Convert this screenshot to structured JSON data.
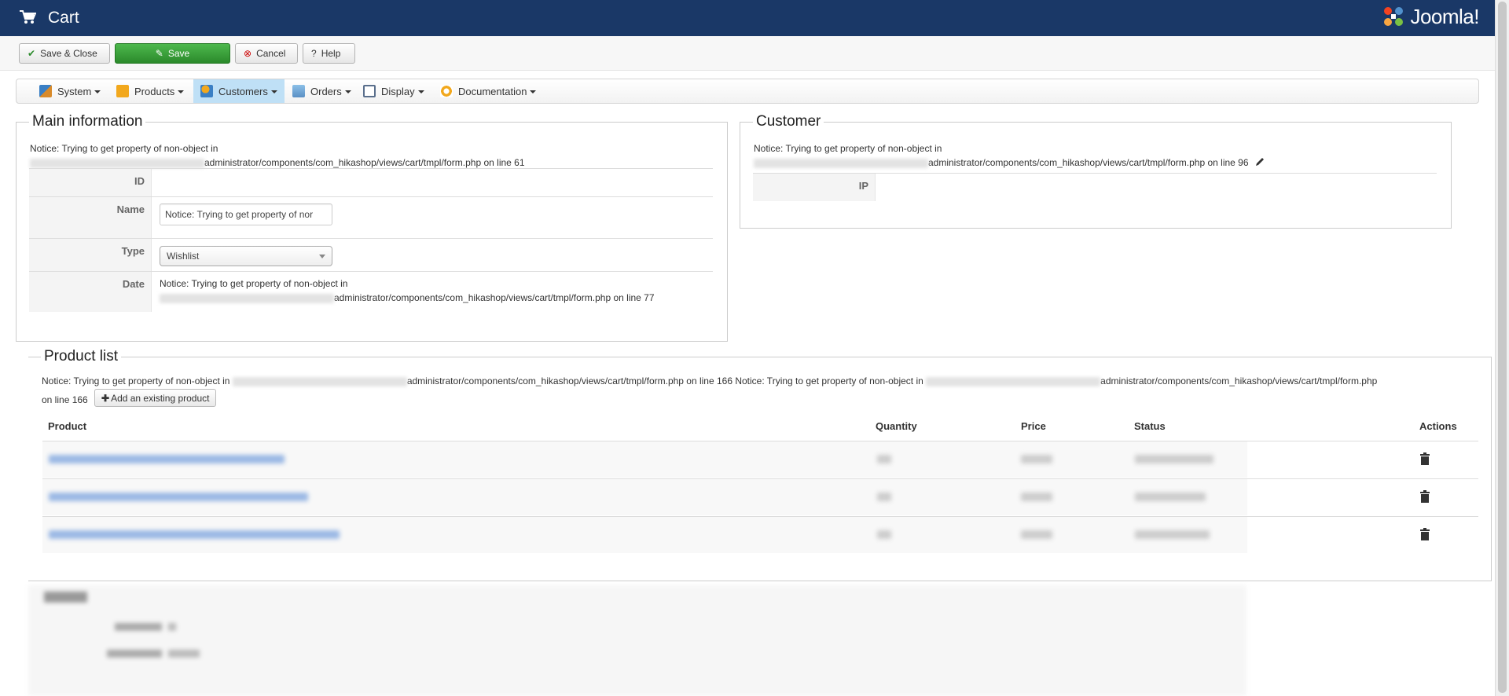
{
  "header": {
    "title": "Cart",
    "logo_text": "Joomla!"
  },
  "toolbar": {
    "save_close": "Save & Close",
    "save": "Save",
    "cancel": "Cancel",
    "help": "Help"
  },
  "menu": [
    {
      "label": "System"
    },
    {
      "label": "Products"
    },
    {
      "label": "Customers"
    },
    {
      "label": "Orders"
    },
    {
      "label": "Display"
    },
    {
      "label": "Documentation"
    }
  ],
  "main_info": {
    "legend": "Main information",
    "notice_line1": "Notice: Trying to get property of non-object in",
    "notice_path": "administrator/components/com_hikashop/views/cart/tmpl/form.php on line 61",
    "id_label": "ID",
    "name_label": "Name",
    "name_value": "Notice: Trying to get property of nor",
    "type_label": "Type",
    "type_value": "Wishlist",
    "date_label": "Date",
    "date_notice_line1": "Notice: Trying to get property of non-object in",
    "date_notice_path": "administrator/components/com_hikashop/views/cart/tmpl/form.php on line 77"
  },
  "customer": {
    "legend": "Customer",
    "notice_line1": "Notice: Trying to get property of non-object in",
    "notice_path": "administrator/components/com_hikashop/views/cart/tmpl/form.php on line 96",
    "ip_label": "IP"
  },
  "product_list": {
    "legend": "Product list",
    "notice_start": "Notice: Trying to get property of non-object in",
    "notice_mid": "administrator/components/com_hikashop/views/cart/tmpl/form.php on line 166 Notice: Trying to get property of non-object in",
    "notice_end": "administrator/components/com_hikashop/views/cart/tmpl/form.php",
    "notice_line2": "on line 166",
    "add_button": "Add an existing product",
    "columns": {
      "product": "Product",
      "quantity": "Quantity",
      "price": "Price",
      "status": "Status",
      "actions": "Actions"
    }
  },
  "colors": {
    "header_bg": "#1a3867",
    "save_green": "#2e8b2e",
    "active_tab": "#bfe0f6"
  }
}
